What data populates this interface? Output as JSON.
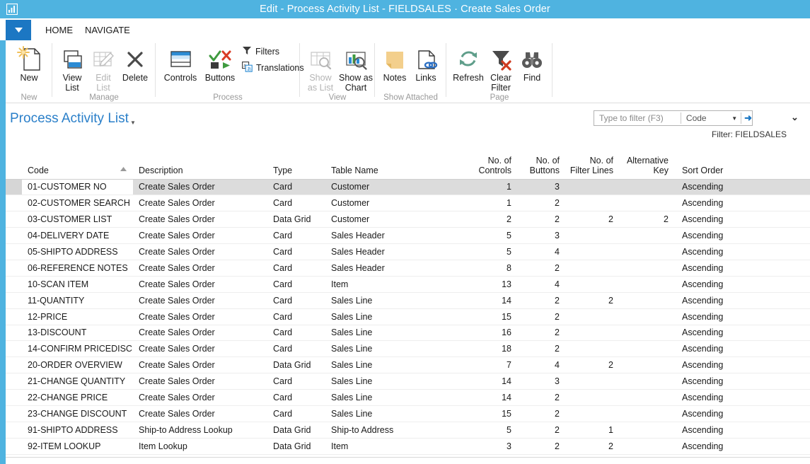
{
  "window": {
    "title": "Edit - Process Activity List - FIELDSALES · Create Sales Order",
    "app_icon": "chart-app-icon"
  },
  "ribbon": {
    "launcher_icon": "chevron-down-icon",
    "tabs": [
      {
        "label": "HOME",
        "active": true
      },
      {
        "label": "NAVIGATE",
        "active": false
      }
    ],
    "groups": [
      {
        "label": "New",
        "buttons": [
          {
            "label": "New",
            "icon": "new-document-icon",
            "disabled": false
          }
        ]
      },
      {
        "label": "Manage",
        "buttons": [
          {
            "label": "View\nList",
            "icon": "view-list-icon",
            "disabled": false
          },
          {
            "label": "Edit\nList",
            "icon": "edit-list-icon",
            "disabled": true
          },
          {
            "label": "Delete",
            "icon": "delete-x-icon",
            "disabled": false
          }
        ]
      },
      {
        "label": "Process",
        "buttons": [
          {
            "label": "Controls",
            "icon": "controls-grid-icon",
            "disabled": false
          },
          {
            "label": "Buttons",
            "icon": "buttons-icon",
            "disabled": false
          }
        ],
        "small_buttons": [
          {
            "label": "Filters",
            "icon": "funnel-icon"
          },
          {
            "label": "Translations",
            "icon": "translations-icon"
          }
        ]
      },
      {
        "label": "View",
        "buttons": [
          {
            "label": "Show\nas List",
            "icon": "show-as-list-icon",
            "disabled": true
          },
          {
            "label": "Show as\nChart",
            "icon": "show-as-chart-icon",
            "disabled": false
          }
        ]
      },
      {
        "label": "Show Attached",
        "buttons": [
          {
            "label": "Notes",
            "icon": "notes-icon",
            "disabled": false
          },
          {
            "label": "Links",
            "icon": "links-icon",
            "disabled": false
          }
        ]
      },
      {
        "label": "Page",
        "buttons": [
          {
            "label": "Refresh",
            "icon": "refresh-icon",
            "disabled": false
          },
          {
            "label": "Clear\nFilter",
            "icon": "clear-filter-icon",
            "disabled": false
          },
          {
            "label": "Find",
            "icon": "binoculars-find-icon",
            "disabled": false
          }
        ]
      }
    ]
  },
  "page": {
    "title": "Process Activity List",
    "title_caret_icon": "caret-down-icon",
    "chevron_icon": "chevron-down-icon",
    "filter_status": "Filter: FIELDSALES"
  },
  "search": {
    "placeholder": "Type to filter (F3)",
    "value": "",
    "field": "Code",
    "field_caret_icon": "caret-down-icon",
    "go_icon": "arrow-right-icon"
  },
  "grid": {
    "sort_indicator_icon": "sort-ascending-icon",
    "sort_column_index": 0,
    "columns": [
      {
        "label": "Code",
        "align": "left"
      },
      {
        "label": "Description",
        "align": "left"
      },
      {
        "label": "Type",
        "align": "left"
      },
      {
        "label": "Table Name",
        "align": "left"
      },
      {
        "label": "No. of\nControls",
        "align": "right"
      },
      {
        "label": "No. of\nButtons",
        "align": "right"
      },
      {
        "label": "No. of\nFilter Lines",
        "align": "right"
      },
      {
        "label": "Alternative\nKey",
        "align": "right"
      },
      {
        "label": "Sort Order",
        "align": "left"
      }
    ],
    "selected_row_index": 0,
    "rows": [
      {
        "code": "01-CUSTOMER NO",
        "description": "Create Sales Order",
        "type": "Card",
        "table_name": "Customer",
        "no_of_controls": "1",
        "no_of_buttons": "3",
        "no_of_filter_lines": "",
        "alternative_key": "",
        "sort_order": "Ascending"
      },
      {
        "code": "02-CUSTOMER SEARCH",
        "description": "Create Sales Order",
        "type": "Card",
        "table_name": "Customer",
        "no_of_controls": "1",
        "no_of_buttons": "2",
        "no_of_filter_lines": "",
        "alternative_key": "",
        "sort_order": "Ascending"
      },
      {
        "code": "03-CUSTOMER LIST",
        "description": "Create Sales Order",
        "type": "Data Grid",
        "table_name": "Customer",
        "no_of_controls": "2",
        "no_of_buttons": "2",
        "no_of_filter_lines": "2",
        "alternative_key": "2",
        "sort_order": "Ascending"
      },
      {
        "code": "04-DELIVERY DATE",
        "description": "Create Sales Order",
        "type": "Card",
        "table_name": "Sales Header",
        "no_of_controls": "5",
        "no_of_buttons": "3",
        "no_of_filter_lines": "",
        "alternative_key": "",
        "sort_order": "Ascending"
      },
      {
        "code": "05-SHIPTO ADDRESS",
        "description": "Create Sales Order",
        "type": "Card",
        "table_name": "Sales Header",
        "no_of_controls": "5",
        "no_of_buttons": "4",
        "no_of_filter_lines": "",
        "alternative_key": "",
        "sort_order": "Ascending"
      },
      {
        "code": "06-REFERENCE NOTES",
        "description": "Create Sales Order",
        "type": "Card",
        "table_name": "Sales Header",
        "no_of_controls": "8",
        "no_of_buttons": "2",
        "no_of_filter_lines": "",
        "alternative_key": "",
        "sort_order": "Ascending"
      },
      {
        "code": "10-SCAN ITEM",
        "description": "Create Sales Order",
        "type": "Card",
        "table_name": "Item",
        "no_of_controls": "13",
        "no_of_buttons": "4",
        "no_of_filter_lines": "",
        "alternative_key": "",
        "sort_order": "Ascending"
      },
      {
        "code": "11-QUANTITY",
        "description": "Create Sales Order",
        "type": "Card",
        "table_name": "Sales Line",
        "no_of_controls": "14",
        "no_of_buttons": "2",
        "no_of_filter_lines": "2",
        "alternative_key": "",
        "sort_order": "Ascending"
      },
      {
        "code": "12-PRICE",
        "description": "Create Sales Order",
        "type": "Card",
        "table_name": "Sales Line",
        "no_of_controls": "15",
        "no_of_buttons": "2",
        "no_of_filter_lines": "",
        "alternative_key": "",
        "sort_order": "Ascending"
      },
      {
        "code": "13-DISCOUNT",
        "description": "Create Sales Order",
        "type": "Card",
        "table_name": "Sales Line",
        "no_of_controls": "16",
        "no_of_buttons": "2",
        "no_of_filter_lines": "",
        "alternative_key": "",
        "sort_order": "Ascending"
      },
      {
        "code": "14-CONFIRM PRICEDISC",
        "description": "Create Sales Order",
        "type": "Card",
        "table_name": "Sales Line",
        "no_of_controls": "18",
        "no_of_buttons": "2",
        "no_of_filter_lines": "",
        "alternative_key": "",
        "sort_order": "Ascending"
      },
      {
        "code": "20-ORDER OVERVIEW",
        "description": "Create Sales Order",
        "type": "Data Grid",
        "table_name": "Sales Line",
        "no_of_controls": "7",
        "no_of_buttons": "4",
        "no_of_filter_lines": "2",
        "alternative_key": "",
        "sort_order": "Ascending"
      },
      {
        "code": "21-CHANGE QUANTITY",
        "description": "Create Sales Order",
        "type": "Card",
        "table_name": "Sales Line",
        "no_of_controls": "14",
        "no_of_buttons": "3",
        "no_of_filter_lines": "",
        "alternative_key": "",
        "sort_order": "Ascending"
      },
      {
        "code": "22-CHANGE PRICE",
        "description": "Create Sales Order",
        "type": "Card",
        "table_name": "Sales Line",
        "no_of_controls": "14",
        "no_of_buttons": "2",
        "no_of_filter_lines": "",
        "alternative_key": "",
        "sort_order": "Ascending"
      },
      {
        "code": "23-CHANGE DISCOUNT",
        "description": "Create Sales Order",
        "type": "Card",
        "table_name": "Sales Line",
        "no_of_controls": "15",
        "no_of_buttons": "2",
        "no_of_filter_lines": "",
        "alternative_key": "",
        "sort_order": "Ascending"
      },
      {
        "code": "91-SHIPTO ADDRESS",
        "description": "Ship-to Address Lookup",
        "type": "Data Grid",
        "table_name": "Ship-to Address",
        "no_of_controls": "5",
        "no_of_buttons": "2",
        "no_of_filter_lines": "1",
        "alternative_key": "",
        "sort_order": "Ascending"
      },
      {
        "code": "92-ITEM LOOKUP",
        "description": "Item Lookup",
        "type": "Data Grid",
        "table_name": "Item",
        "no_of_controls": "3",
        "no_of_buttons": "2",
        "no_of_filter_lines": "2",
        "alternative_key": "",
        "sort_order": "Ascending"
      }
    ]
  },
  "colors": {
    "title_bar": "#4fb3e0",
    "accent": "#1c77c3",
    "page_title": "#2a7fc9",
    "selection": "#dcdcdc"
  }
}
